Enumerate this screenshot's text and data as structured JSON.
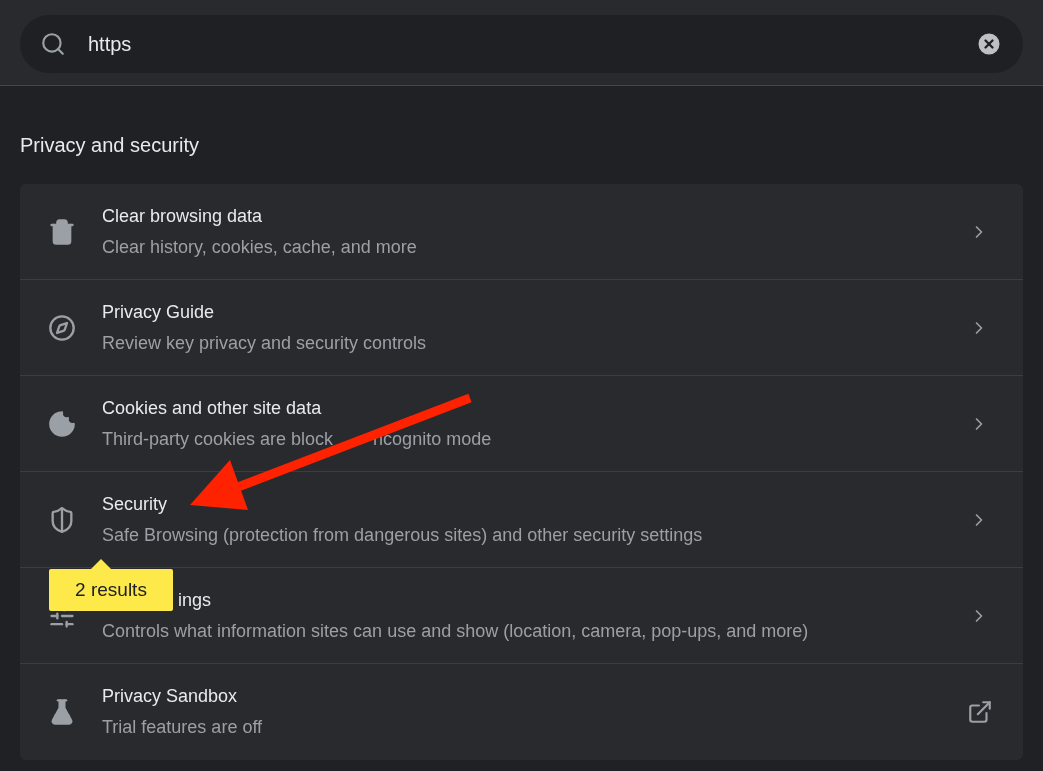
{
  "search": {
    "value": "https"
  },
  "section_title": "Privacy and security",
  "rows": [
    {
      "title": "Clear browsing data",
      "subtitle": [
        "Clear history, cookies, cache, and more"
      ]
    },
    {
      "title": "Privacy Guide",
      "subtitle": [
        "Review key privacy and security controls"
      ]
    },
    {
      "title": "Cookies and other site data",
      "subtitle": [
        "Third-party cookies are block",
        "ncognito mode"
      ]
    },
    {
      "title": "Security",
      "subtitle": [
        "Safe Browsing (protection from dangerous sites) and other security settings"
      ]
    },
    {
      "title": "ings",
      "subtitle": [
        "Controls what information sites can use and show (location, camera, pop-ups, and more)"
      ]
    },
    {
      "title": "Privacy Sandbox",
      "subtitle": [
        "Trial features are off"
      ]
    }
  ],
  "tooltip": {
    "text": "2 results"
  }
}
